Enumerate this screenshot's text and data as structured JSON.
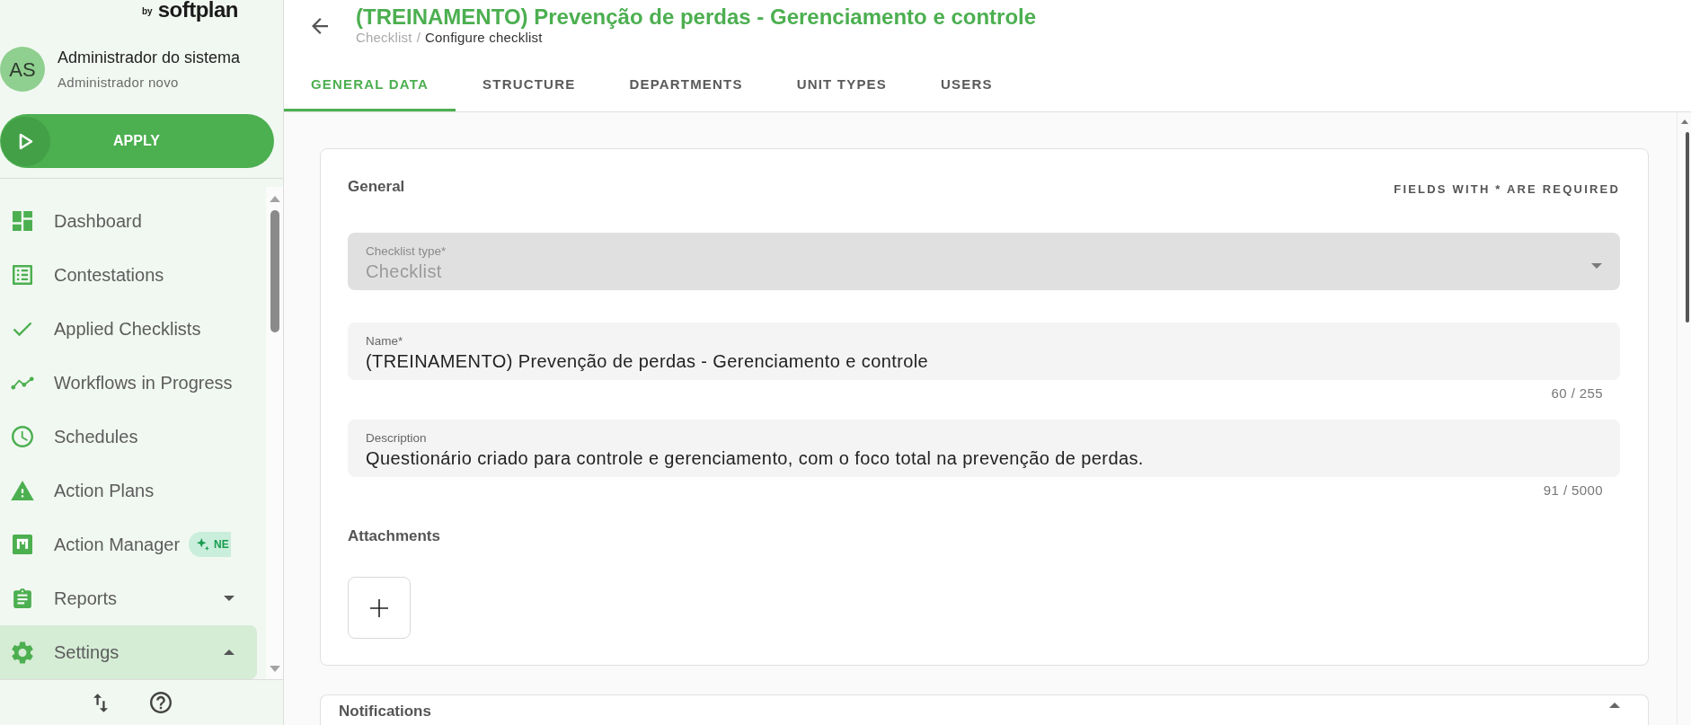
{
  "sidebar": {
    "logo": {
      "prefix": "by",
      "wordmark": "softplan"
    },
    "user": {
      "initials": "AS",
      "name": "Administrador do sistema",
      "role": "Administrador novo"
    },
    "apply_button": {
      "label": "APPLY"
    },
    "menu": [
      {
        "label": "Dashboard",
        "kind": "link",
        "selected": false
      },
      {
        "label": "Contestations",
        "kind": "link",
        "selected": false
      },
      {
        "label": "Applied Checklists",
        "kind": "link",
        "selected": false
      },
      {
        "label": "Workflows in Progress",
        "kind": "link",
        "selected": false
      },
      {
        "label": "Schedules",
        "kind": "link",
        "selected": false
      },
      {
        "label": "Action Plans",
        "kind": "link",
        "selected": false
      },
      {
        "label": "Action Manager",
        "kind": "link",
        "selected": false,
        "badge": "NE"
      },
      {
        "label": "Reports",
        "kind": "group",
        "selected": false,
        "expanded": false
      },
      {
        "label": "Settings",
        "kind": "group",
        "selected": true,
        "expanded": true
      }
    ]
  },
  "header": {
    "title": "(TREINAMENTO) Prevenção de perdas - Gerenciamento e controle",
    "breadcrumb": {
      "separator": "/",
      "items": [
        {
          "label": "Checklist",
          "current": false
        },
        {
          "label": "Configure checklist",
          "current": true
        }
      ]
    }
  },
  "tabs": [
    {
      "label": "GENERAL DATA",
      "selected": true
    },
    {
      "label": "STRUCTURE",
      "selected": false
    },
    {
      "label": "DEPARTMENTS",
      "selected": false
    },
    {
      "label": "UNIT TYPES",
      "selected": false
    },
    {
      "label": "USERS",
      "selected": false
    }
  ],
  "general_card": {
    "title": "General",
    "required_note": "FIELDS WITH * ARE REQUIRED",
    "fields": [
      {
        "kind": "select",
        "label": "Checklist type*",
        "value": "Checklist",
        "disabled": true
      },
      {
        "kind": "text",
        "label": "Name*",
        "value": "(TREINAMENTO) Prevenção de perdas - Gerenciamento e controle",
        "disabled": false,
        "counter": "60 / 255"
      },
      {
        "kind": "textarea",
        "label": "Description",
        "value": "Questionário criado para controle e gerenciamento, com o foco total na prevenção de perdas.",
        "disabled": false,
        "counter": "91 / 5000"
      }
    ],
    "attachments_title": "Attachments"
  },
  "notifications_card": {
    "title": "Notifications"
  }
}
